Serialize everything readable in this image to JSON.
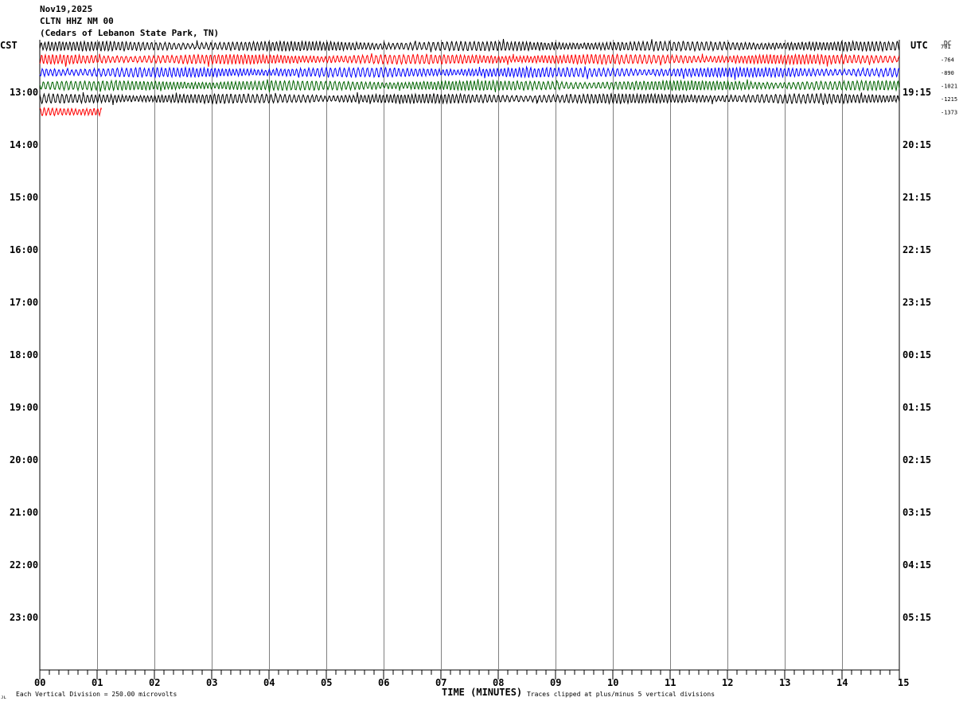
{
  "header": {
    "date": "Nov19,2025",
    "station": "CLTN HHZ NM 00",
    "location": "(Cedars of Lebanon State Park, TN)"
  },
  "axis_labels": {
    "left_zone": "CST",
    "right_zone": "UTC",
    "dc_label": "DC",
    "x_title": "TIME (MINUTES)"
  },
  "footer": {
    "scale_note": "Each Vertical Division =  250.00 microvolts",
    "clip_note": "Traces clipped at plus/minus 5 vertical divisions",
    "corner_mark": "ᴊʟ"
  },
  "chart_data": {
    "type": "line",
    "x_range_minutes": [
      0,
      15
    ],
    "x_ticks": [
      "00",
      "01",
      "02",
      "03",
      "04",
      "05",
      "06",
      "07",
      "08",
      "09",
      "10",
      "11",
      "12",
      "13",
      "14",
      "15"
    ],
    "rows_per_hour": 4,
    "row_minutes": 15,
    "grid_vertical_lines": true,
    "left_hour_labels": [
      "13:00",
      "14:00",
      "15:00",
      "16:00",
      "17:00",
      "18:00",
      "19:00",
      "20:00",
      "21:00",
      "22:00",
      "23:00"
    ],
    "right_hour_labels": [
      "19:15",
      "20:15",
      "21:15",
      "22:15",
      "23:15",
      "00:15",
      "01:15",
      "02:15",
      "03:15",
      "04:15",
      "05:15"
    ],
    "series": [
      {
        "row": 0,
        "color": "#000000",
        "start_min": 0,
        "end_min": 15,
        "dc_offset": "701"
      },
      {
        "row": 1,
        "color": "#ff0000",
        "start_min": 0,
        "end_min": 15,
        "dc_offset": "-764"
      },
      {
        "row": 2,
        "color": "#0000ff",
        "start_min": 0,
        "end_min": 15,
        "dc_offset": "-890"
      },
      {
        "row": 3,
        "color": "#006400",
        "start_min": 0,
        "end_min": 15,
        "dc_offset": "-1021"
      },
      {
        "row": 4,
        "color": "#000000",
        "start_min": 0,
        "end_min": 15,
        "dc_offset": "-1215"
      },
      {
        "row": 5,
        "color": "#ff0000",
        "start_min": 0,
        "end_min": 1.08,
        "dc_offset": "-1373"
      }
    ]
  }
}
